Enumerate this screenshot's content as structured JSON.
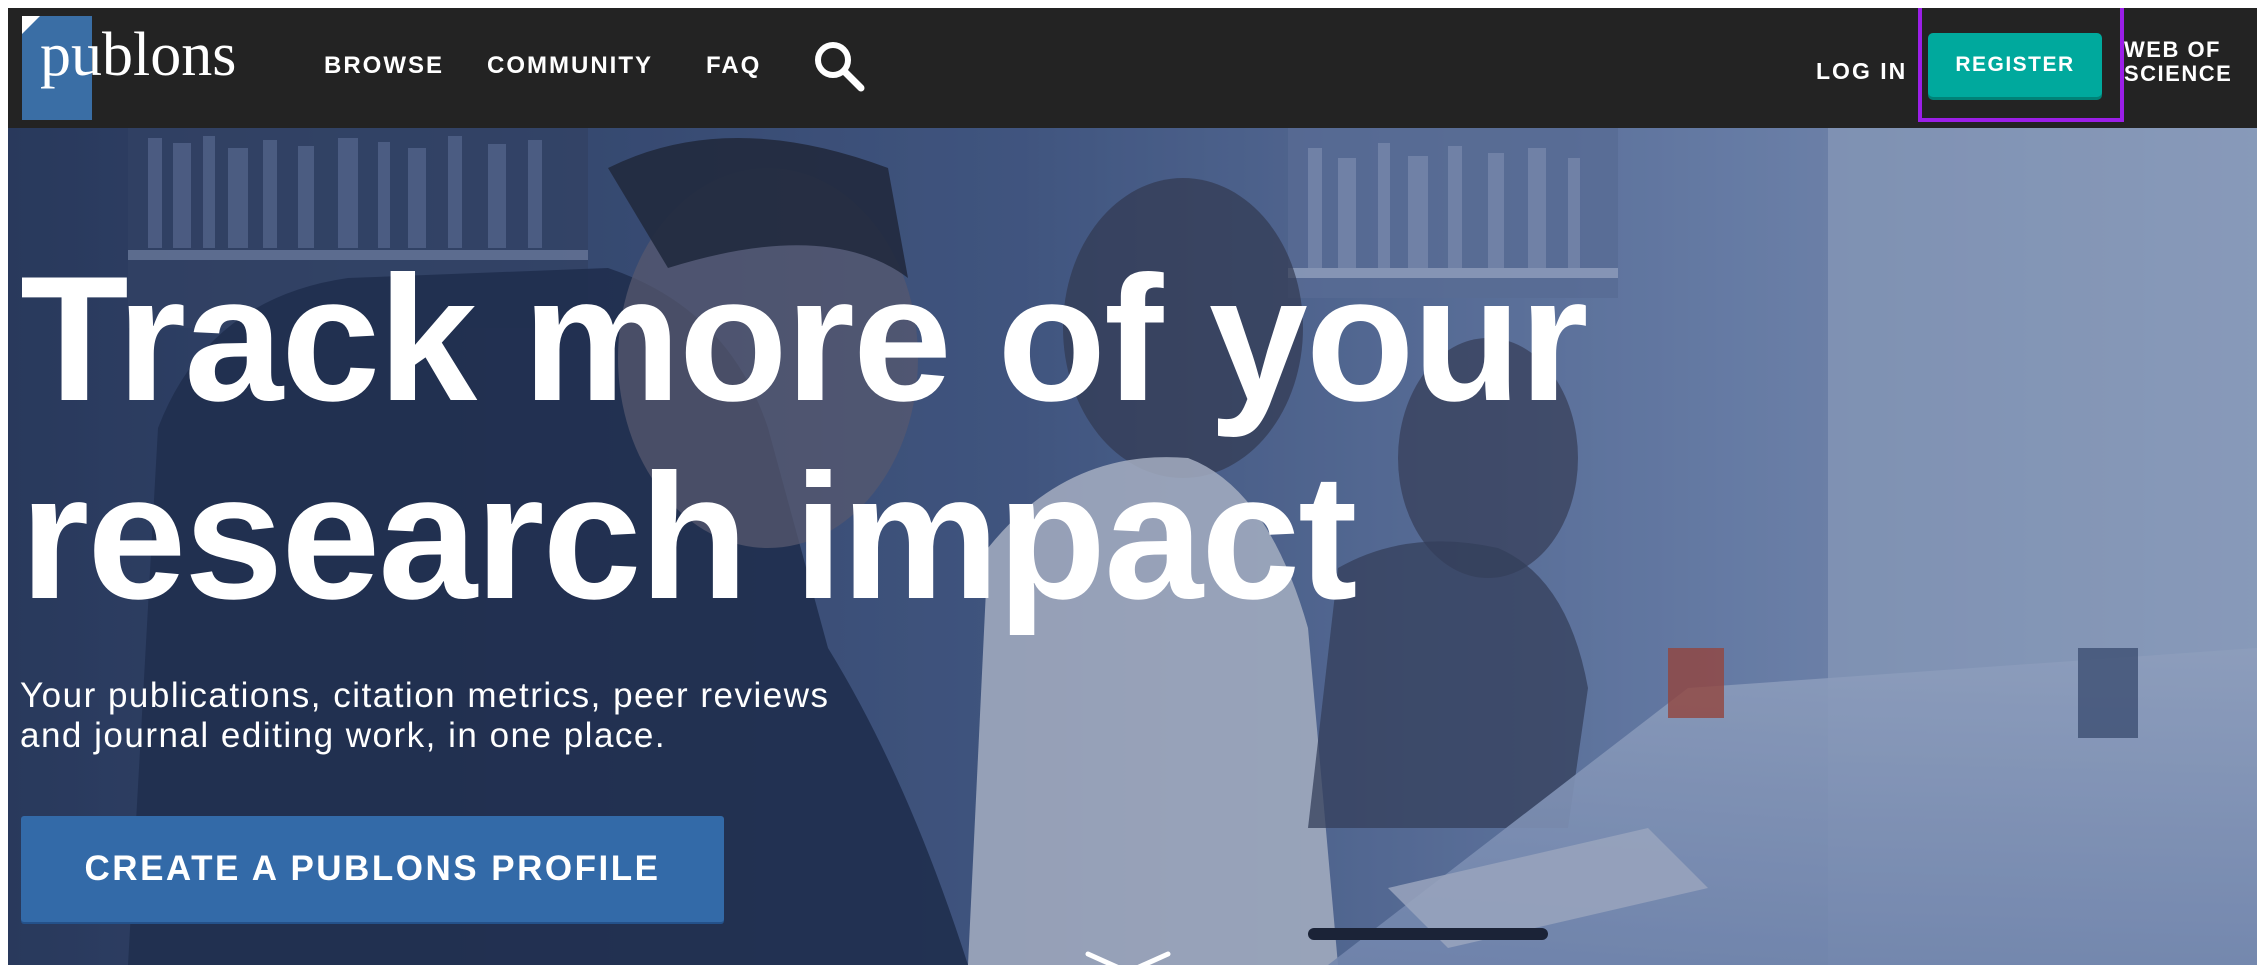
{
  "header": {
    "logo_text": "publons",
    "nav": [
      {
        "label": "BROWSE"
      },
      {
        "label": "COMMUNITY"
      },
      {
        "label": "FAQ"
      }
    ],
    "search_icon": "search-icon",
    "login_label": "LOG IN",
    "register_label": "REGISTER",
    "web_of_science_line1": "WEB OF",
    "web_of_science_line2": "SCIENCE"
  },
  "hero": {
    "title_line1": "Track more of your",
    "title_line2": "research impact",
    "subtitle_line1": "Your publications, citation metrics, peer reviews",
    "subtitle_line2": "and journal editing work, in one place.",
    "cta_label": "CREATE A PUBLONS PROFILE",
    "scroll_icon": "chevron-down-icon"
  },
  "colors": {
    "topbar": "#232323",
    "logo_square": "#3a6ea5",
    "register_button": "#00a99d",
    "highlight_box": "#9b1fe8",
    "cta_button": "#336aa8",
    "hero_overlay": "#5f78a6"
  }
}
